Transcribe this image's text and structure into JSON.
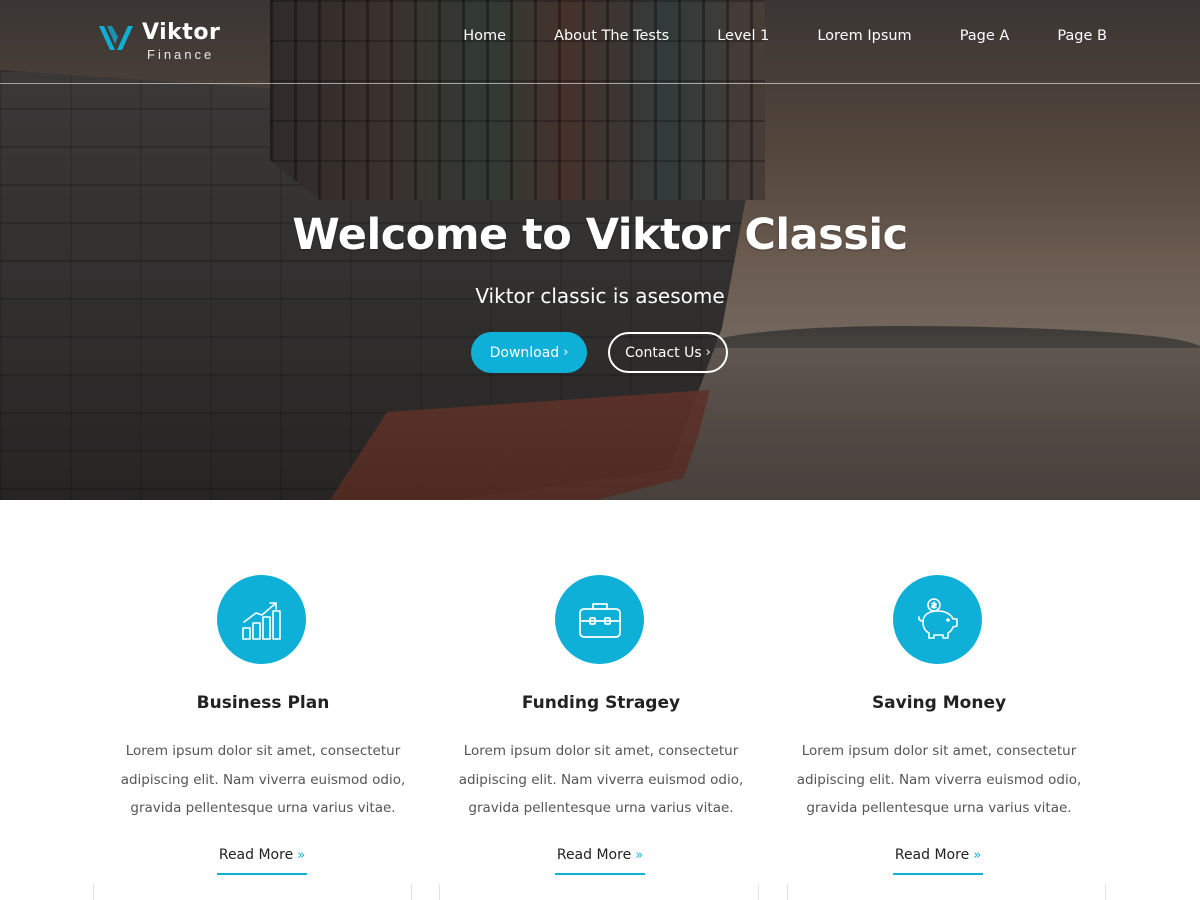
{
  "brand": {
    "name": "Viktor",
    "tagline": "Finance",
    "accent": "#0fb0d8"
  },
  "nav": {
    "items": [
      {
        "label": "Home"
      },
      {
        "label": "About The Tests"
      },
      {
        "label": "Level 1"
      },
      {
        "label": "Lorem Ipsum"
      },
      {
        "label": "Page A"
      },
      {
        "label": "Page B"
      }
    ]
  },
  "hero": {
    "title": "Welcome to Viktor Classic",
    "subtitle": "Viktor classic is asesome",
    "buttons": {
      "download": {
        "label": "Download",
        "icon": "chevron-right-icon"
      },
      "contact": {
        "label": "Contact Us",
        "icon": "chevron-right-icon"
      }
    }
  },
  "features": [
    {
      "icon": "growth-chart-icon",
      "title": "Business Plan",
      "text": "Lorem ipsum dolor sit amet, consectetur adipiscing elit. Nam viverra euismod odio, gravida pellentesque urna varius vitae.",
      "link": "Read More"
    },
    {
      "icon": "briefcase-icon",
      "title": "Funding Stragey",
      "text": "Lorem ipsum dolor sit amet, consectetur adipiscing elit. Nam viverra euismod odio, gravida pellentesque urna varius vitae.",
      "link": "Read More"
    },
    {
      "icon": "piggy-bank-icon",
      "title": "Saving Money",
      "text": "Lorem ipsum dolor sit amet, consectetur adipiscing elit. Nam viverra euismod odio, gravida pellentesque urna varius vitae.",
      "link": "Read More"
    }
  ]
}
